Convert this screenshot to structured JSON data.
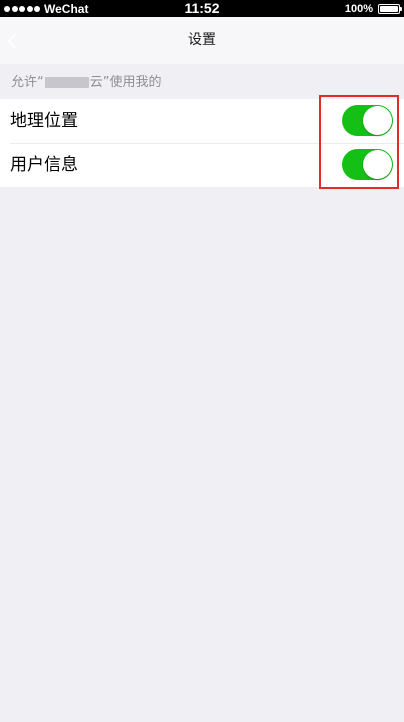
{
  "status_bar": {
    "carrier": "WeChat",
    "time": "11:52",
    "battery_percent": "100%",
    "signal_bars": 5
  },
  "nav": {
    "title": "设置",
    "back_icon": "chevron-left-icon"
  },
  "section": {
    "header_prefix": "允许“",
    "header_suffix": "云”使用我的"
  },
  "settings": [
    {
      "label": "地理位置",
      "enabled": true
    },
    {
      "label": "用户信息",
      "enabled": true
    }
  ],
  "colors": {
    "toggle_on": "#15c016",
    "highlight": "#e32b2b",
    "background": "#efeff4"
  }
}
